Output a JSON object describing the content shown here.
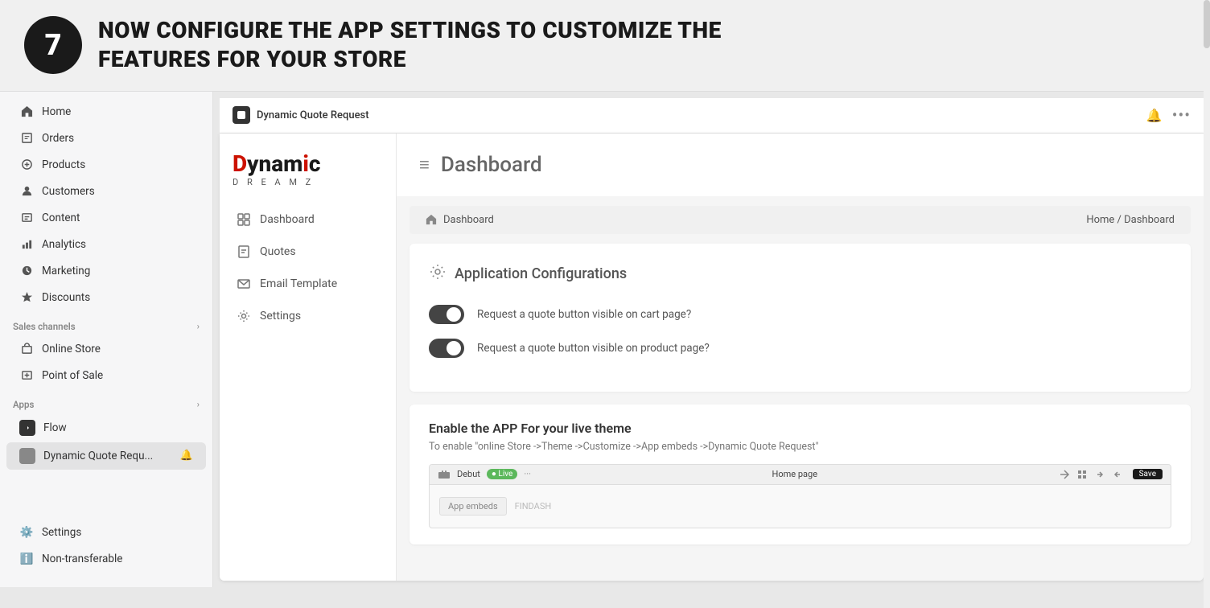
{
  "banner": {
    "step": "7",
    "text_line1": "NOW CONFIGURE THE APP SETTINGS TO CUSTOMIZE THE",
    "text_line2": "FEATURES FOR YOUR STORE"
  },
  "shopify_sidebar": {
    "items": [
      {
        "id": "home",
        "label": "Home",
        "icon": "🏠"
      },
      {
        "id": "orders",
        "label": "Orders",
        "icon": "📦"
      },
      {
        "id": "products",
        "label": "Products",
        "icon": "🏷️"
      },
      {
        "id": "customers",
        "label": "Customers",
        "icon": "👤"
      },
      {
        "id": "content",
        "label": "Content",
        "icon": "🖥️"
      },
      {
        "id": "analytics",
        "label": "Analytics",
        "icon": "📊"
      },
      {
        "id": "marketing",
        "label": "Marketing",
        "icon": "🎯"
      },
      {
        "id": "discounts",
        "label": "Discounts",
        "icon": "🏷️"
      }
    ],
    "sales_channels_label": "Sales channels",
    "sales_channels": [
      {
        "id": "online-store",
        "label": "Online Store",
        "icon": "🏪"
      },
      {
        "id": "pos",
        "label": "Point of Sale",
        "icon": "💳"
      }
    ],
    "apps_label": "Apps",
    "apps": [
      {
        "id": "flow",
        "label": "Flow",
        "icon": "⚡"
      }
    ],
    "app_active": {
      "label": "Dynamic Quote Requ...",
      "bell": "🔔"
    },
    "bottom_items": [
      {
        "id": "settings",
        "label": "Settings",
        "icon": "⚙️"
      },
      {
        "id": "non-transferable",
        "label": "Non-transferable",
        "icon": "ℹ️"
      }
    ]
  },
  "topbar": {
    "app_name": "Dynamic Quote Request",
    "bell_icon": "🔔",
    "more_icon": "⋯"
  },
  "app_sidebar": {
    "logo_d": "D",
    "logo_rest": "ynamic",
    "logo_accent": "i",
    "logo_subtitle": "D  R  E  A  M  Z",
    "nav_items": [
      {
        "id": "dashboard",
        "label": "Dashboard",
        "icon": "house"
      },
      {
        "id": "quotes",
        "label": "Quotes",
        "icon": "doc"
      },
      {
        "id": "email-template",
        "label": "Email Template",
        "icon": "mail"
      },
      {
        "id": "settings",
        "label": "Settings",
        "icon": "gear"
      }
    ]
  },
  "dashboard": {
    "menu_icon": "≡",
    "title": "Dashboard",
    "breadcrumb_left_icon": "🏠",
    "breadcrumb_left": "Dashboard",
    "breadcrumb_right": "Home / Dashboard",
    "config_section": {
      "icon": "⚙️",
      "title": "Application Configurations",
      "toggles": [
        {
          "id": "cart-toggle",
          "label": "Request a quote button visible on cart page?",
          "enabled": true
        },
        {
          "id": "product-toggle",
          "label": "Request a quote button visible on product page?",
          "enabled": true
        }
      ]
    },
    "live_theme": {
      "title": "Enable the APP For your live theme",
      "description": "To enable \"online Store ->Theme ->Customize ->App embeds ->Dynamic Quote Request\"",
      "preview_bar_items": [
        "Debut",
        "● Live",
        "···",
        "Home page",
        "↕"
      ],
      "preview_content": "App embeds",
      "preview_content2": "FINDASH"
    }
  }
}
